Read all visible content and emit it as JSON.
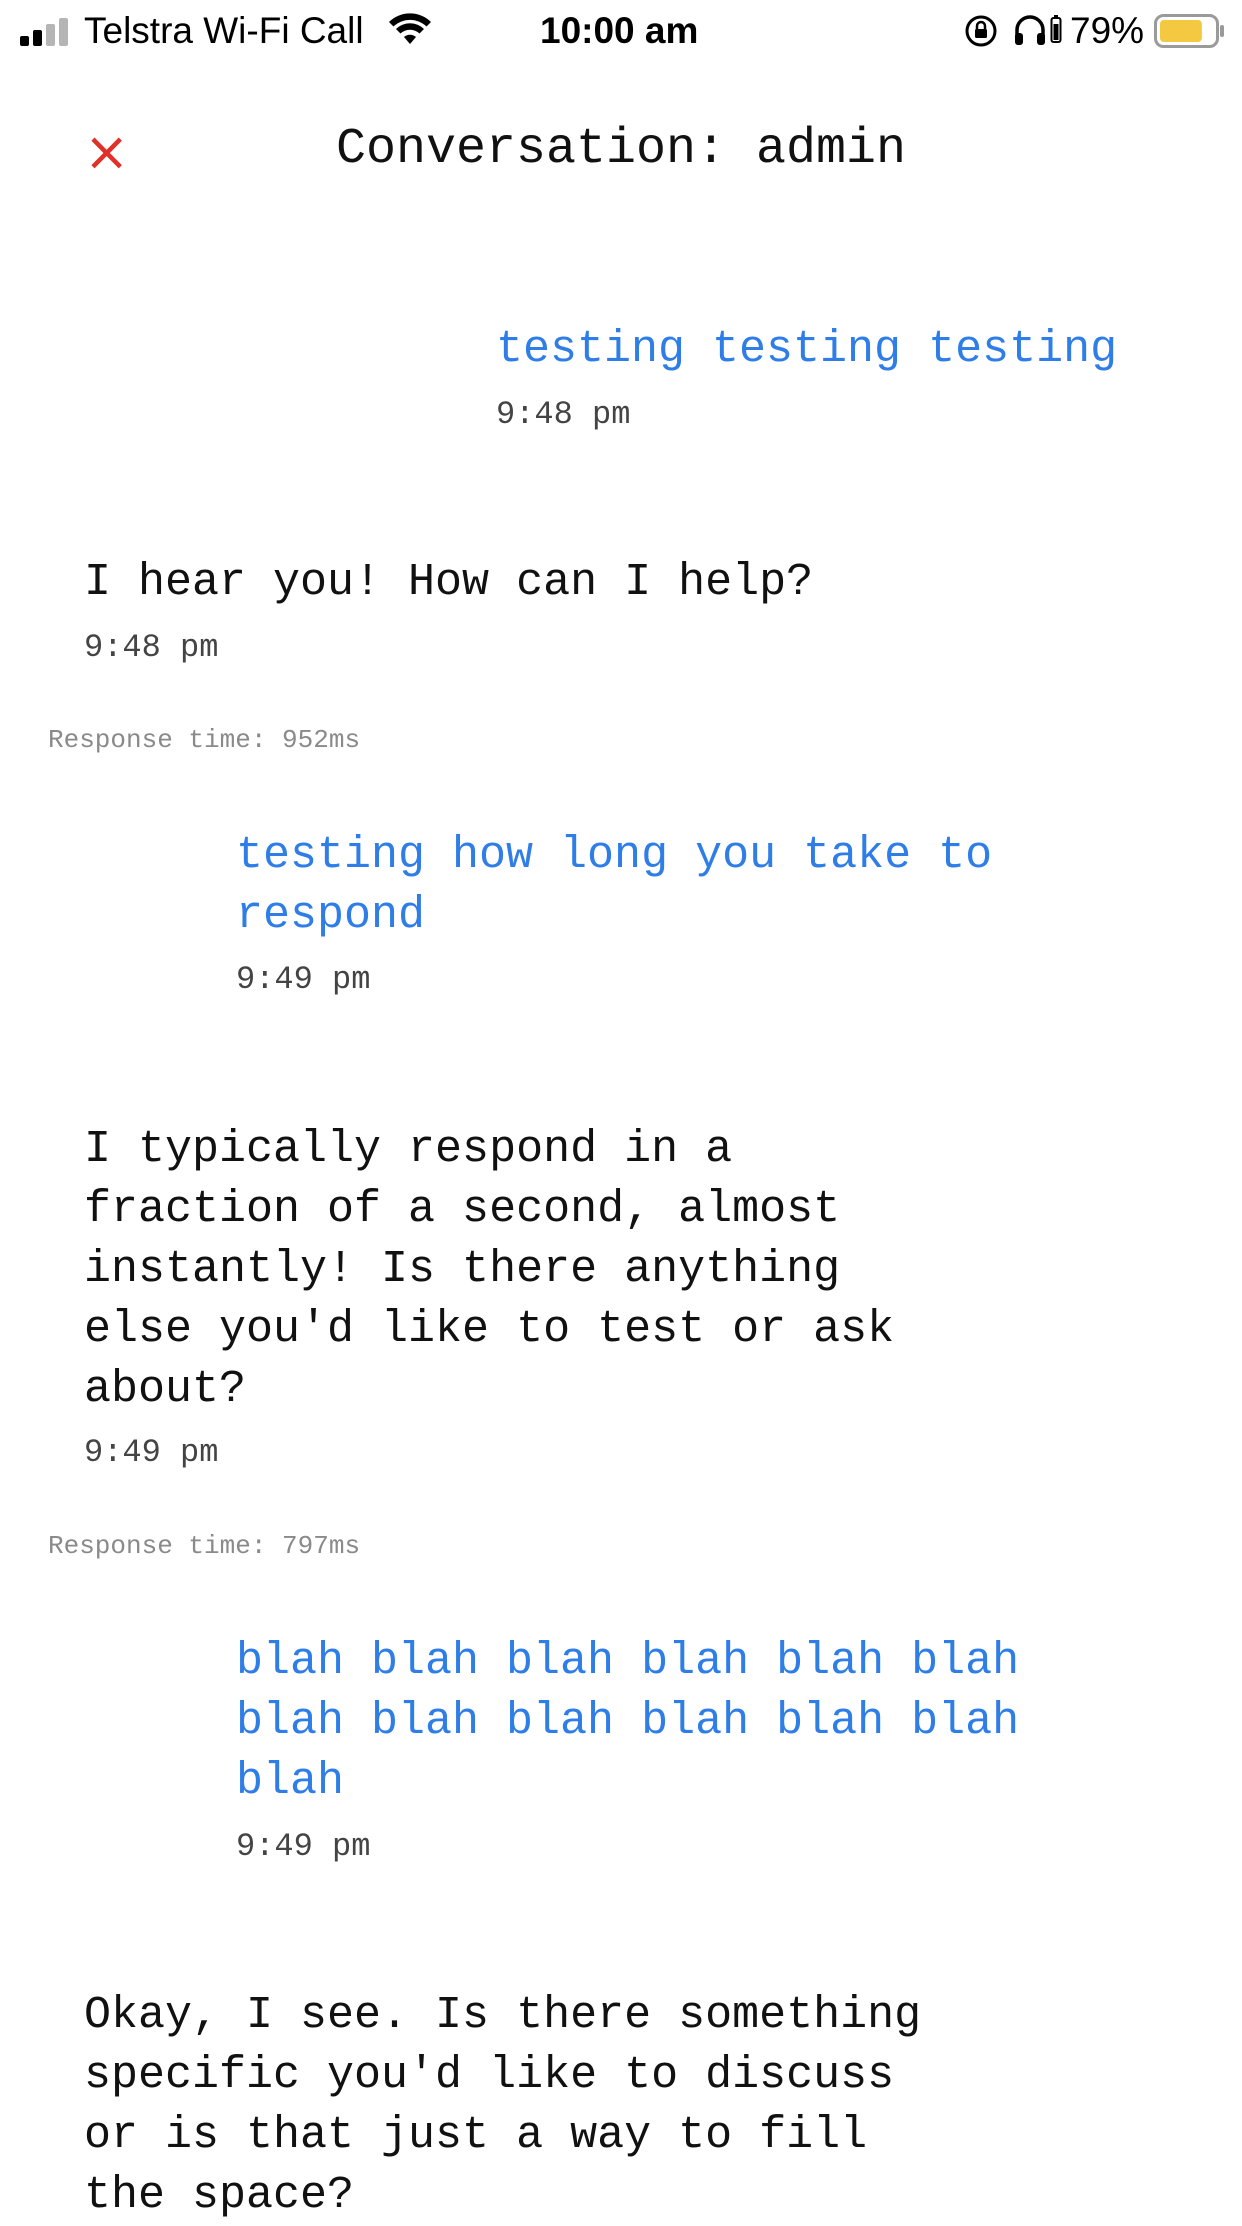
{
  "status_bar": {
    "carrier": "Telstra Wi-Fi Call",
    "time": "10:00 am",
    "battery_percent": "79%",
    "battery_color": "#f5c842",
    "icons": [
      "signal-icon",
      "wifi-icon",
      "orientation-lock-icon",
      "headphones-icon",
      "battery-icon"
    ]
  },
  "header": {
    "close_icon": "×",
    "title": "Conversation: admin"
  },
  "colors": {
    "user_text": "#2f7ee8",
    "bot_text": "#111111",
    "close": "#e0302a"
  },
  "messages": [
    {
      "role": "user",
      "text": "testing testing testing",
      "time": "9:48 pm"
    },
    {
      "role": "bot",
      "text": "I hear you! How can I help?",
      "time": "9:48 pm",
      "response_time": "Response time: 952ms"
    },
    {
      "role": "user",
      "text": "testing how long you take to\nrespond",
      "time": "9:49 pm"
    },
    {
      "role": "bot",
      "text": "I typically respond in a\nfraction of a second, almost\ninstantly! Is there anything\nelse you'd like to test or ask\nabout?",
      "time": "9:49 pm",
      "response_time": "Response time: 797ms"
    },
    {
      "role": "user",
      "text": "blah blah blah blah blah blah\nblah blah blah blah blah blah\nblah",
      "time": "9:49 pm"
    },
    {
      "role": "bot",
      "text": "Okay, I see. Is there something\nspecific you'd like to discuss\nor is that just a way to fill\nthe space?"
    }
  ]
}
